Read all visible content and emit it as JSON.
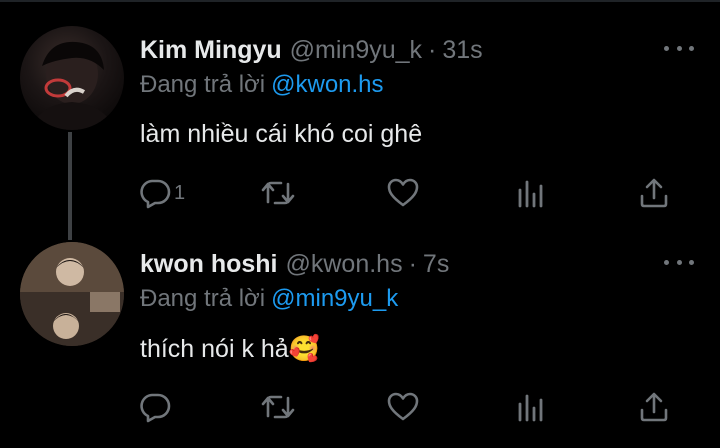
{
  "colors": {
    "background": "#000000",
    "primary_text": "#e7e9ea",
    "secondary_text": "#71767b",
    "link": "#1d9bf0",
    "thread_line": "#3e4144"
  },
  "tweets": [
    {
      "display_name": "Kim Mingyu",
      "handle": "@min9yu_k",
      "separator": "·",
      "time": "31s",
      "reply_prefix": "Đang trả lời",
      "reply_to": "@kwon.hs",
      "text": "làm nhiều cái khó coi ghê",
      "reply_count": "1",
      "icons": [
        "more-icon",
        "reply-icon",
        "retweet-icon",
        "like-icon",
        "stats-icon",
        "share-icon"
      ]
    },
    {
      "display_name": "kwon hoshi",
      "handle": "@kwon.hs",
      "separator": "·",
      "time": "7s",
      "reply_prefix": "Đang trả lời",
      "reply_to": "@min9yu_k",
      "text": "thích nói k hả🥰",
      "reply_count": "",
      "icons": [
        "more-icon",
        "reply-icon",
        "retweet-icon",
        "like-icon",
        "stats-icon",
        "share-icon"
      ]
    }
  ]
}
